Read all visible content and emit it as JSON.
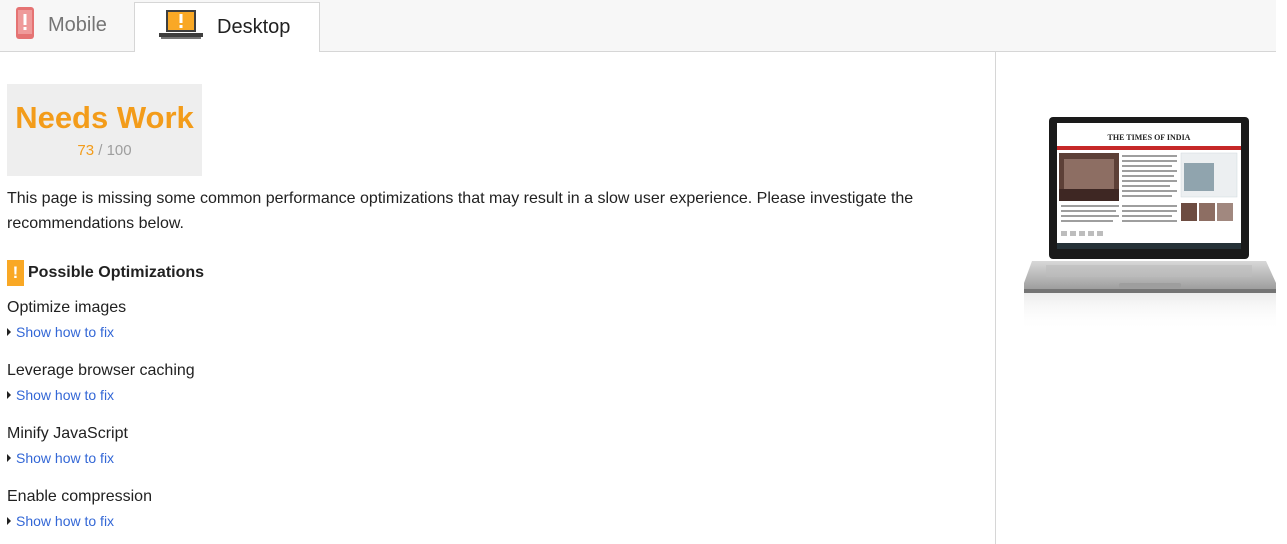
{
  "tabs": [
    {
      "label": "Mobile",
      "icon": "mobile-phone-warning-icon",
      "active": false
    },
    {
      "label": "Desktop",
      "icon": "desktop-warning-icon",
      "active": true
    }
  ],
  "score": {
    "title": "Needs Work",
    "value": "73",
    "max": "/ 100",
    "color": "#f39c1a"
  },
  "description": "This page is missing some common performance optimizations that may result in a slow user experience. Please investigate the recommendations below.",
  "optimizations": {
    "title": "Possible Optimizations",
    "warning_mark": "!",
    "items": [
      {
        "name": "Optimize images",
        "link": "Show how to fix"
      },
      {
        "name": "Leverage browser caching",
        "link": "Show how to fix"
      },
      {
        "name": "Minify JavaScript",
        "link": "Show how to fix"
      },
      {
        "name": "Enable compression",
        "link": "Show how to fix"
      }
    ]
  },
  "preview": {
    "site_title": "THE TIMES OF INDIA",
    "icon": "laptop-screenshot-preview"
  }
}
